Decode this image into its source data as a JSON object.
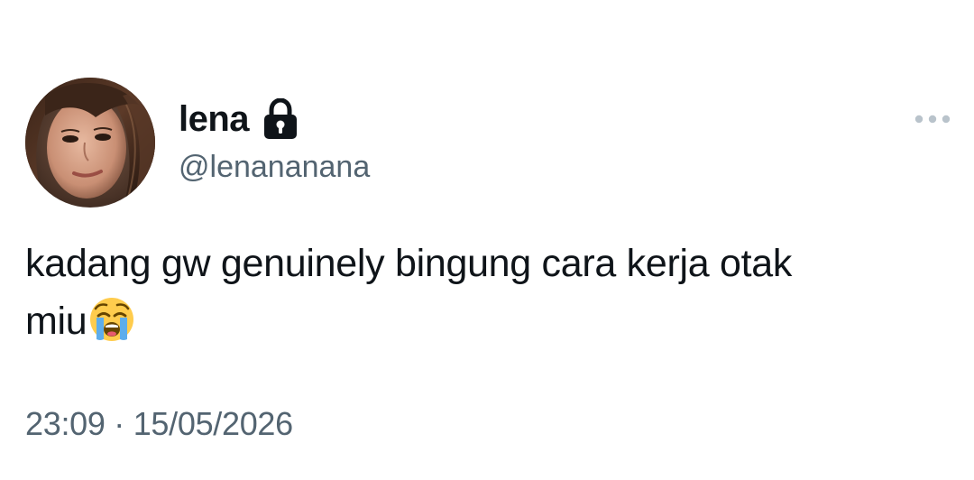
{
  "tweet": {
    "author": {
      "display_name": "lena",
      "handle": "@lenananana",
      "protected_icon": "lock-icon",
      "avatar": "profile-photo"
    },
    "more_icon": "more-options-icon",
    "text_main": "kadang gw genuinely bingung cara kerja otak",
    "text_tail": "miu",
    "emoji": "loudly-crying-face-emoji",
    "time": "23:09",
    "separator": "·",
    "date": "15/05/2026"
  },
  "colors": {
    "text_primary": "#0f1419",
    "text_secondary": "#536471",
    "background": "#ffffff",
    "more_dots": "#b9c3cb"
  }
}
